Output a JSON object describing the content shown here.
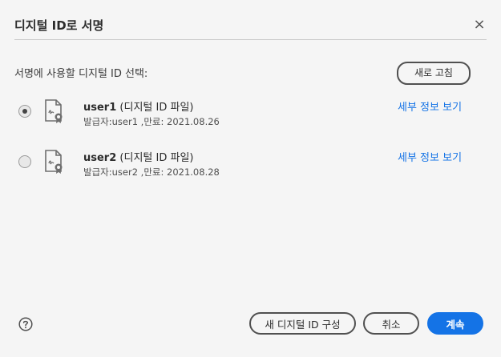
{
  "dialog": {
    "title": "디지털 ID로 서명",
    "close_symbol": "×",
    "prompt": "서명에 사용할 디지털 ID 선택:",
    "refresh_label": "새로 고침"
  },
  "ids": [
    {
      "name": "user1",
      "type": "(디지털 ID 파일)",
      "issuer_info": "발급자:user1 ,만료: 2021.08.26",
      "details_label": "세부 정보 보기",
      "selected": true
    },
    {
      "name": "user2",
      "type": "(디지털 ID 파일)",
      "issuer_info": "발급자:user2 ,만료: 2021.08.28",
      "details_label": "세부 정보 보기",
      "selected": false
    }
  ],
  "footer": {
    "help_icon": "help-circle-icon",
    "configure_label": "새 디지털 ID 구성",
    "cancel_label": "취소",
    "continue_label": "계속"
  },
  "colors": {
    "accent": "#1473e6",
    "background": "#f5f5f5",
    "text": "#2c2c2c"
  }
}
